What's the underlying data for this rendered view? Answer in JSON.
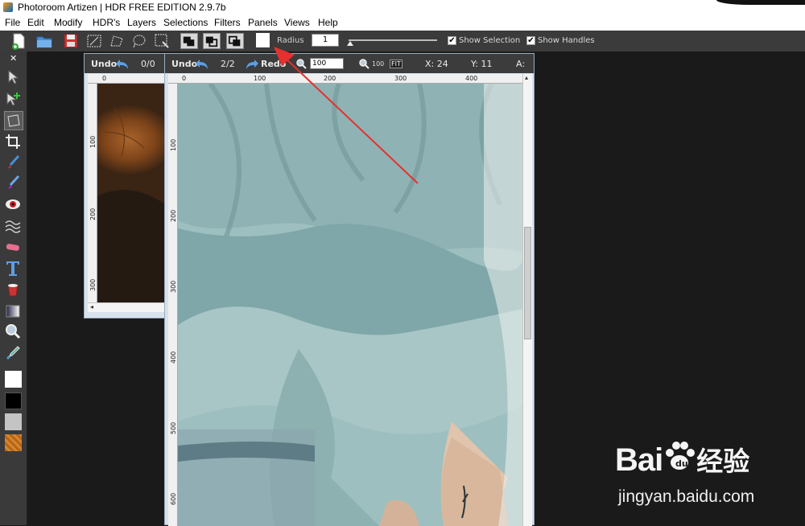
{
  "window": {
    "title": "Photoroom Artizen | HDR FREE EDITION 2.9.7b"
  },
  "menu": [
    "File",
    "Edit",
    "Modify",
    "HDR's",
    "Layers",
    "Selections",
    "Filters",
    "Panels",
    "Views",
    "Help"
  ],
  "toolbar": {
    "radius_label": "Radius",
    "radius_value": "1",
    "show_selection_label": "Show Selection",
    "show_handles_label": "Show Handles",
    "show_selection_checked": "✔",
    "show_handles_checked": "✔"
  },
  "palette": {
    "close_label": "✕"
  },
  "doc1": {
    "undo_label": "Undo",
    "undo_count": "0/0",
    "ruler_h": [
      "0"
    ],
    "ruler_v": [
      "100",
      "200",
      "300"
    ]
  },
  "doc2": {
    "undo_label": "Undo",
    "undo_count": "2/2",
    "redo_label": "Redo",
    "zoom_value": "100",
    "zoom_100": "100",
    "fit_label": "FIT",
    "x_label": "X: 24",
    "y_label": "Y: 11",
    "a_label": "A:",
    "ruler_h": [
      "0",
      "100",
      "200",
      "300",
      "400"
    ],
    "ruler_v": [
      "100",
      "200",
      "300",
      "400",
      "500",
      "600"
    ]
  },
  "watermark": {
    "brand": "Bai",
    "brand2": "经验",
    "url": "jingyan.baidu.com"
  },
  "colors": {
    "arrow": "#e53030",
    "toolbar_bg": "#3b3b3b",
    "doc_frame": "#d8e2ec",
    "cloth": "#8fb3b4"
  }
}
